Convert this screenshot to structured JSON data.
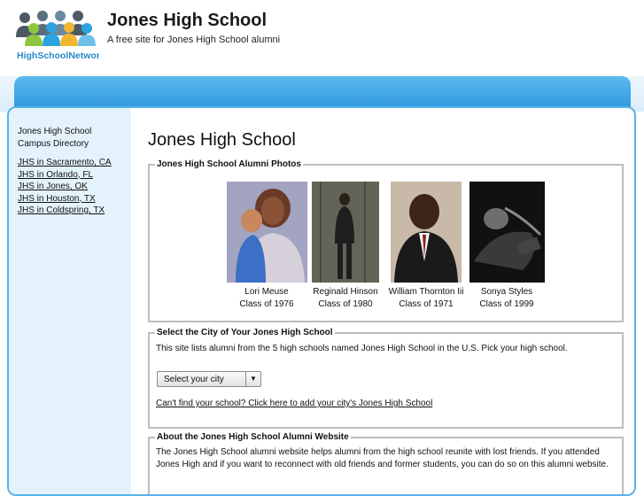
{
  "header": {
    "logo_text": "HighSchoolNetwork",
    "title": "Jones High School",
    "tagline": "A free site for Jones High School alumni"
  },
  "sidebar": {
    "heading_line1": "Jones High School",
    "heading_line2": "Campus Directory",
    "links": [
      {
        "label": "JHS in Sacramento, CA"
      },
      {
        "label": "JHS in Orlando, FL"
      },
      {
        "label": "JHS in Jones, OK"
      },
      {
        "label": "JHS in Houston, TX"
      },
      {
        "label": "JHS in Coldspring, TX"
      }
    ]
  },
  "main": {
    "title": "Jones High School",
    "photos": {
      "legend": "Jones High School Alumni Photos",
      "items": [
        {
          "name": "Lori Meuse",
          "class": "Class of 1976"
        },
        {
          "name": "Reginald Hinson",
          "class": "Class of 1980"
        },
        {
          "name": "William Thornton Iii",
          "class": "Class of 1971"
        },
        {
          "name": "Sonya Styles",
          "class": "Class of 1999"
        }
      ]
    },
    "city": {
      "legend": "Select the City of Your Jones High School",
      "description": "This site lists alumni from the 5 high schools named Jones High School in the U.S. Pick your high school.",
      "select_value": "Select your city",
      "cant_find": "Can't find your school? Click here to add your city's Jones High School"
    },
    "about": {
      "legend": "About the Jones High School Alumni Website",
      "text": "The Jones High School alumni website helps alumni from the high school reunite with lost friends. If you attended Jones High and if you want to reconnect with old friends and former students, you can do so on this alumni website."
    }
  },
  "colors": {
    "banner": "#2c97dd",
    "frame_border": "#5ab3e8",
    "sidebar_bg": "#e4f2fc"
  }
}
